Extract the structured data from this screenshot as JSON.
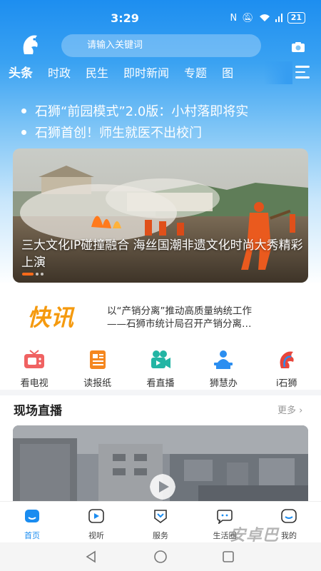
{
  "status": {
    "time": "3:29",
    "battery": "21"
  },
  "search": {
    "placeholder": "请输入关键词"
  },
  "tabs": [
    "头条",
    "时政",
    "民生",
    "即时新闻",
    "专题",
    "图"
  ],
  "ticker": [
    "石狮“前园模式”2.0版：小村落即将实",
    "石狮首创！师生就医不出校门"
  ],
  "banner": {
    "caption": "三大文化IP碰撞融合 海丝国潮非遗文化时尚大秀精彩上演"
  },
  "flash": {
    "logo": "快讯",
    "line1": "以“产销分离”推动高质量纳统工作",
    "line2": "——石狮市统计局召开产销分离…"
  },
  "quick_links": [
    {
      "label": "看电视",
      "icon": "tv-icon",
      "color": "#f06262"
    },
    {
      "label": "读报纸",
      "icon": "newspaper-icon",
      "color": "#f5871f"
    },
    {
      "label": "看直播",
      "icon": "video-camera-icon",
      "color": "#23b5a4"
    },
    {
      "label": "狮慧办",
      "icon": "service-desk-icon",
      "color": "#2b8ef0"
    },
    {
      "label": "i石狮",
      "icon": "lion-logo-icon",
      "color": "#e8463c"
    }
  ],
  "live_section": {
    "title": "现场直播",
    "more": "更多"
  },
  "bottom_nav": [
    {
      "label": "首页",
      "icon": "home-icon",
      "active": true
    },
    {
      "label": "视听",
      "icon": "video-icon",
      "active": false
    },
    {
      "label": "服务",
      "icon": "service-icon",
      "active": false
    },
    {
      "label": "生活圈",
      "icon": "chat-icon",
      "active": false
    },
    {
      "label": "我的",
      "icon": "profile-icon",
      "active": false
    }
  ],
  "watermark": "安卓巴",
  "colors": {
    "accent": "#1a8cf0",
    "flash_orange": "#f59a0e",
    "progress_orange": "#ff6a1a"
  }
}
